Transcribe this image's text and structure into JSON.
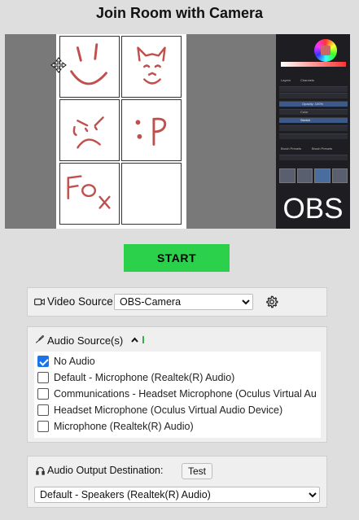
{
  "page": {
    "title": "Join Room with Camera"
  },
  "preview": {
    "obs_text": "OBS",
    "obs_panel_labels": {
      "tab_layers": "Layers",
      "tab_channels": "Channels",
      "opacity": "Opacity: 100%",
      "layer_color": "Color",
      "layer_sketch": "Sketch",
      "brush_presets": "Brush Presets",
      "brush_tags": "Brush Presets"
    }
  },
  "start_button": {
    "label": "START",
    "color": "#2bd14a"
  },
  "video": {
    "label": "Video Source",
    "selected": "OBS-Camera",
    "options": [
      "OBS-Camera"
    ]
  },
  "audio_sources": {
    "label": "Audio Source(s)",
    "items": [
      {
        "label": "No Audio",
        "checked": true
      },
      {
        "label": "Default - Microphone (Realtek(R) Audio)",
        "checked": false
      },
      {
        "label": "Communications - Headset Microphone (Oculus Virtual Au",
        "checked": false
      },
      {
        "label": "Headset Microphone (Oculus Virtual Audio Device)",
        "checked": false
      },
      {
        "label": "Microphone (Realtek(R) Audio)",
        "checked": false
      }
    ]
  },
  "audio_output": {
    "label": "Audio Output Destination:",
    "test_label": "Test",
    "selected": "Default - Speakers (Realtek(R) Audio)",
    "options": [
      "Default - Speakers (Realtek(R) Audio)"
    ]
  },
  "colors": {
    "accent_blue": "#1a73e8",
    "meter_green": "#2bb24c",
    "sketch_red": "#c0504d"
  }
}
